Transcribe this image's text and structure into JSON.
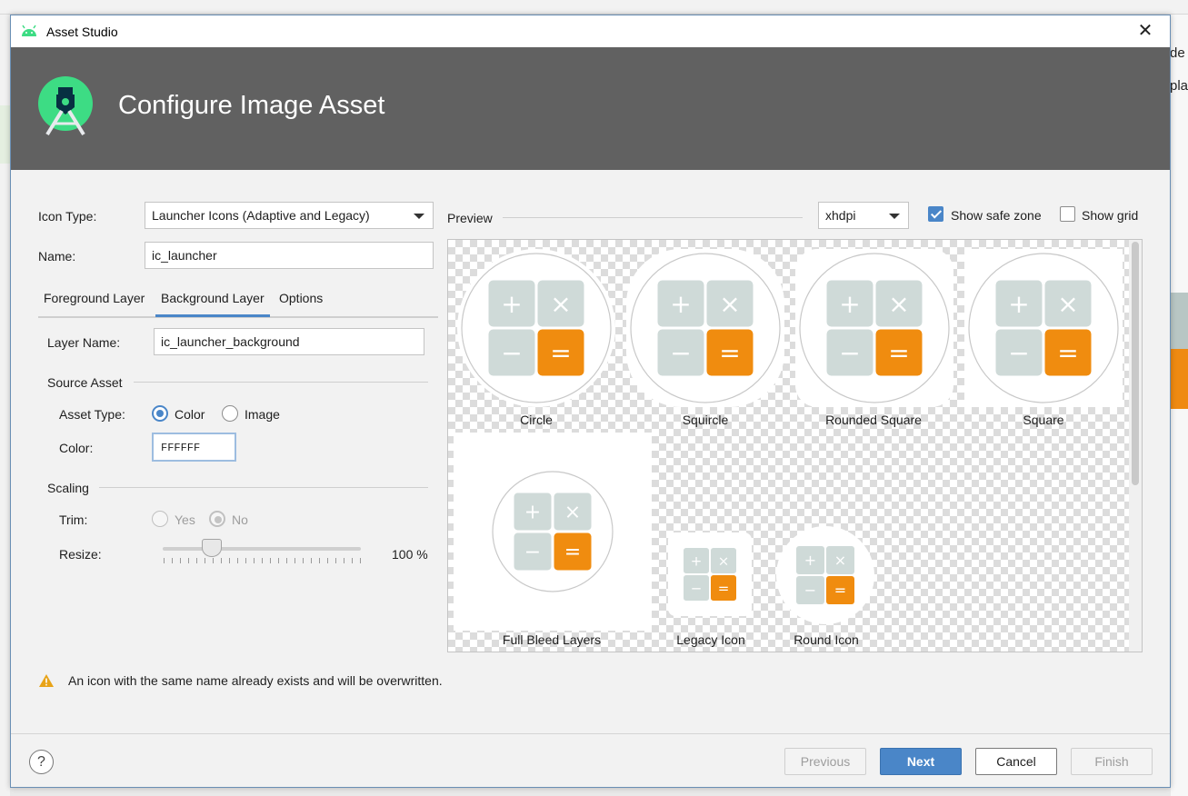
{
  "window": {
    "title": "Asset Studio",
    "close_glyph": "✕"
  },
  "header": {
    "title": "Configure Image Asset"
  },
  "background_app": {
    "right_text_1": "de",
    "right_text_2": "pla"
  },
  "form": {
    "icon_type_label": "Icon Type:",
    "icon_type_value": "Launcher Icons (Adaptive and Legacy)",
    "name_label": "Name:",
    "name_value": "ic_launcher"
  },
  "tabs": [
    {
      "label": "Foreground Layer"
    },
    {
      "label": "Background Layer",
      "active": true
    },
    {
      "label": "Options"
    }
  ],
  "layer": {
    "layer_name_label": "Layer Name:",
    "layer_name_value": "ic_launcher_background",
    "source_asset_title": "Source Asset",
    "asset_type_label": "Asset Type:",
    "asset_type_options": [
      "Color",
      "Image"
    ],
    "asset_type_selected": "Color",
    "color_label": "Color:",
    "color_value": "FFFFFF",
    "scaling_title": "Scaling",
    "trim_label": "Trim:",
    "trim_options": [
      "Yes",
      "No"
    ],
    "trim_selected": "No",
    "resize_label": "Resize:",
    "resize_value": "100 %"
  },
  "preview": {
    "title": "Preview",
    "density_value": "xhdpi",
    "show_safe_zone_label": "Show safe zone",
    "show_safe_zone_checked": true,
    "show_grid_label": "Show grid",
    "show_grid_checked": false,
    "labels": {
      "circle": "Circle",
      "squircle": "Squircle",
      "rounded_square": "Rounded Square",
      "square": "Square",
      "full_bleed": "Full Bleed Layers",
      "legacy": "Legacy Icon",
      "round": "Round Icon"
    },
    "glyphs": {
      "plus": "+",
      "times": "×",
      "minus": "−",
      "equals": "="
    }
  },
  "colors": {
    "header_bg": "#616161",
    "accent": "#4a86c8",
    "tile_gray": "#cfdad8",
    "tile_orange": "#f08c0f",
    "android_green": "#3ddc84",
    "warning": "#e8a317"
  },
  "warning": {
    "text": "An icon with the same name already exists and will be overwritten."
  },
  "footer": {
    "help_label": "?",
    "previous_label": "Previous",
    "next_label": "Next",
    "cancel_label": "Cancel",
    "finish_label": "Finish"
  }
}
